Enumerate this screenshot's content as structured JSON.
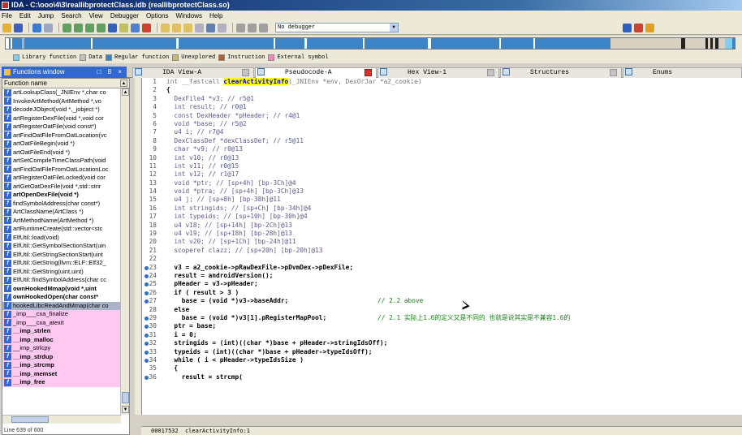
{
  "window": {
    "title": "IDA - C:\\ooo\\4\\3\\reallibprotectClass.idb (reallibprotectClass.so)"
  },
  "menu": [
    "File",
    "Edit",
    "Jump",
    "Search",
    "View",
    "Debugger",
    "Options",
    "Windows",
    "Help"
  ],
  "toolbar": {
    "debugger_select": "No debugger"
  },
  "legend": [
    {
      "label": "Library function",
      "color": "#7fd0f0"
    },
    {
      "label": "Data",
      "color": "#c0c0c0"
    },
    {
      "label": "Regular function",
      "color": "#3b85c7"
    },
    {
      "label": "Unexplored",
      "color": "#c8b878"
    },
    {
      "label": "Instruction",
      "color": "#b06030"
    },
    {
      "label": "External symbol",
      "color": "#ff80c0"
    }
  ],
  "functions_window": {
    "title": "Functions window",
    "controls": "□ 8 ×",
    "column_header": "Function name",
    "status": "Line 639 of 600",
    "items": [
      {
        "name": "artLookupClass(_JNIEnv *,char co",
        "bold": false,
        "pink": false
      },
      {
        "name": "InvokeArtMethod(ArtMethod *,vo",
        "bold": false,
        "pink": false
      },
      {
        "name": "decodeJObject(void *,_jobject *)",
        "bold": false,
        "pink": false
      },
      {
        "name": "artRegisterDexFile(void *,void cor",
        "bold": false,
        "pink": false
      },
      {
        "name": "artRegisterOatFile(void const*)",
        "bold": false,
        "pink": false
      },
      {
        "name": "artFindOatFileFromOatLocation(vc",
        "bold": false,
        "pink": false
      },
      {
        "name": "artOatFileBegin(void *)",
        "bold": false,
        "pink": false
      },
      {
        "name": "artOatFileEnd(void *)",
        "bold": false,
        "pink": false
      },
      {
        "name": "artSetCompileTimeClassPath(void",
        "bold": false,
        "pink": false
      },
      {
        "name": "artFindOatFileFromOatLocationLoc",
        "bold": false,
        "pink": false
      },
      {
        "name": "artRegisterOatFileLocked(void cor",
        "bold": false,
        "pink": false
      },
      {
        "name": "artGetOatDexFile(void *,std::strir",
        "bold": false,
        "pink": false
      },
      {
        "name": "artOpenDexFile(void *)",
        "bold": true,
        "pink": false
      },
      {
        "name": "findSymbolAddress(char const*)",
        "bold": false,
        "pink": false
      },
      {
        "name": "ArtClassName(ArtClass *)",
        "bold": false,
        "pink": false
      },
      {
        "name": "ArtMethodName(ArtMethod *)",
        "bold": false,
        "pink": false
      },
      {
        "name": "artRuntimeCreate(std::vector<stc",
        "bold": false,
        "pink": false
      },
      {
        "name": "ElfUtil::load(void)",
        "bold": false,
        "pink": false
      },
      {
        "name": "ElfUtil::GetSymbolSectionStart(uin",
        "bold": false,
        "pink": false
      },
      {
        "name": "ElfUtil::GetStringSectionStart(uint",
        "bold": false,
        "pink": false
      },
      {
        "name": "ElfUtil::GetString(llvm::ELF::Elf32_",
        "bold": false,
        "pink": false
      },
      {
        "name": "ElfUtil::GetString(uint,uint)",
        "bold": false,
        "pink": false
      },
      {
        "name": "ElfUtil::findSymbolAddress(char cc",
        "bold": false,
        "pink": false
      },
      {
        "name": "ownHookedMmap(void *,uint",
        "bold": true,
        "pink": false
      },
      {
        "name": "ownHookedOpen(char const*",
        "bold": true,
        "pink": false
      },
      {
        "name": "hookedLibcReadAndMmap(char co",
        "bold": false,
        "pink": false,
        "selected": true
      },
      {
        "name": "_imp___cxa_finalize",
        "bold": false,
        "pink": true
      },
      {
        "name": "_imp___cxa_atexit",
        "bold": false,
        "pink": true
      },
      {
        "name": "__imp_strlen",
        "bold": true,
        "pink": true
      },
      {
        "name": "__imp_malloc",
        "bold": true,
        "pink": true
      },
      {
        "name": "__imp_strlcpy",
        "bold": false,
        "pink": true
      },
      {
        "name": "__imp_strdup",
        "bold": true,
        "pink": true
      },
      {
        "name": "__imp_strcmp",
        "bold": true,
        "pink": true
      },
      {
        "name": "__imp_memset",
        "bold": true,
        "pink": true
      },
      {
        "name": "__imp_free",
        "bold": true,
        "pink": true
      }
    ]
  },
  "tabs": [
    {
      "label": "IDA View-A",
      "close_red": false
    },
    {
      "label": "Pseudocode-A",
      "close_red": true
    },
    {
      "label": "Hex View-1",
      "close_red": false
    },
    {
      "label": "Structures",
      "close_red": false
    },
    {
      "label": "Enums",
      "close_red": false
    }
  ],
  "code": {
    "lines": [
      {
        "n": "1",
        "pre": "int __fastcall ",
        "hl": "clearActivityInfo",
        "post": "(_JNIEnv *env, DexOrJar *a2_cookie)",
        "style": "sig"
      },
      {
        "n": "2",
        "text": "{"
      },
      {
        "n": "3",
        "text": "  DexFile4 *v3; // r5@1",
        "style": "decl"
      },
      {
        "n": "4",
        "text": "  int result; // r0@1",
        "style": "decl"
      },
      {
        "n": "5",
        "text": "  const DexHeader *pHeader; // r4@1",
        "style": "decl"
      },
      {
        "n": "6",
        "text": "  void *base; // r5@2",
        "style": "decl"
      },
      {
        "n": "7",
        "text": "  u4 i; // r7@4",
        "style": "decl"
      },
      {
        "n": "8",
        "text": "  DexClassDef *dexClassDef; // r5@11",
        "style": "decl"
      },
      {
        "n": "9",
        "text": "  char *v9; // r0@13",
        "style": "decl"
      },
      {
        "n": "10",
        "text": "  int v10; // r0@13",
        "style": "decl"
      },
      {
        "n": "11",
        "text": "  int v11; // r0@15",
        "style": "decl"
      },
      {
        "n": "12",
        "text": "  int v12; // r1@17",
        "style": "decl"
      },
      {
        "n": "13",
        "text": "  void *ptr; // [sp+4h] [bp-3Ch]@4",
        "style": "decl"
      },
      {
        "n": "14",
        "text": "  void *ptra; // [sp+4h] [bp-3Ch]@13",
        "style": "decl"
      },
      {
        "n": "15",
        "text": "  u4 j; // [sp+8h] [bp-38h]@11",
        "style": "decl"
      },
      {
        "n": "16",
        "text": "  int stringids; // [sp+Ch] [bp-34h]@4",
        "style": "decl"
      },
      {
        "n": "17",
        "text": "  int typeids; // [sp+10h] [bp-30h]@4",
        "style": "decl"
      },
      {
        "n": "18",
        "text": "  u4 v18; // [sp+14h] [bp-2Ch]@13",
        "style": "decl"
      },
      {
        "n": "19",
        "text": "  u4 v19; // [sp+18h] [bp-28h]@13",
        "style": "decl"
      },
      {
        "n": "20",
        "text": "  int v20; // [sp+1Ch] [bp-24h]@11",
        "style": "decl"
      },
      {
        "n": "21",
        "text": "  scoperef clazz; // [sp+20h] [bp-20h]@13",
        "style": "decl"
      },
      {
        "n": "22",
        "text": ""
      },
      {
        "n": "23",
        "text": "  v3 = a2_cookie->pRawDexFile->pDvmDex->pDexFile;",
        "dot": true
      },
      {
        "n": "24",
        "text": "  result = androidVersion();",
        "dot": true
      },
      {
        "n": "25",
        "text": "  pHeader = v3->pHeader;",
        "dot": true
      },
      {
        "n": "26",
        "text": "  if ( result > 3 )",
        "dot": true
      },
      {
        "n": "27",
        "text": "    base = (void *)v3->baseAddr;",
        "dot": true,
        "comment": "// 2.2 above"
      },
      {
        "n": "28",
        "text": "  else"
      },
      {
        "n": "29",
        "text": "    base = (void *)v3[1].pRegisterMapPool;",
        "dot": true,
        "comment": "// 2.1 实际上1.6的定义又是不同的 也就是说其实是不兼容1.6的"
      },
      {
        "n": "30",
        "text": "  ptr = base;",
        "dot": true
      },
      {
        "n": "31",
        "text": "  i = 0;",
        "dot": true
      },
      {
        "n": "32",
        "text": "  stringids = (int)((char *)base + pHeader->stringIdsOff);",
        "dot": true
      },
      {
        "n": "33",
        "text": "  typeids = (int)((char *)base + pHeader->typeIdsOff);",
        "dot": true
      },
      {
        "n": "34",
        "text": "  while ( i < pHeader->typeIdsSize )",
        "dot": true
      },
      {
        "n": "35",
        "text": "  {"
      },
      {
        "n": "36",
        "text": "    result = strcmp(",
        "dot": true
      }
    ]
  },
  "status": {
    "addr": "00017532",
    "func": "clearActivityInfo:1"
  }
}
